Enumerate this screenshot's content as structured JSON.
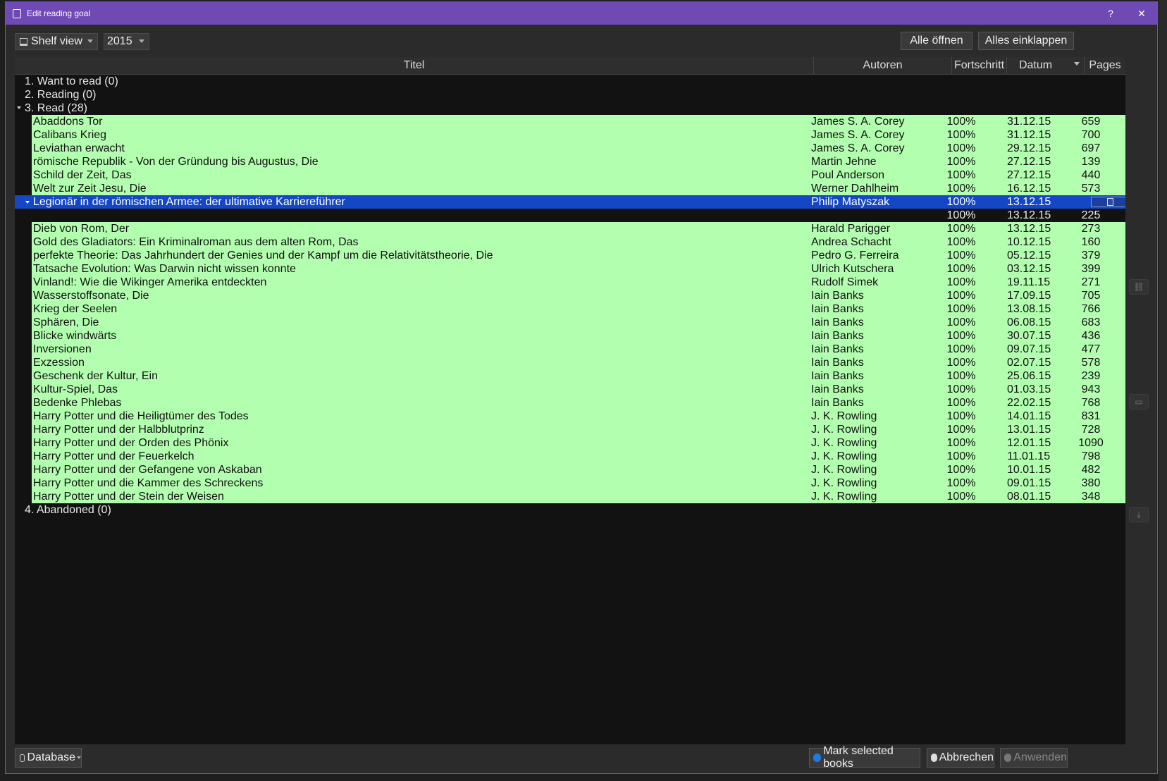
{
  "window": {
    "title": "Edit reading goal",
    "help": "?",
    "close": "✕"
  },
  "toolbar": {
    "view_label": "Shelf view",
    "year": "2015",
    "expand_all": "Alle öffnen",
    "collapse_all": "Alles einklappen"
  },
  "columns": {
    "title": "Titel",
    "authors": "Autoren",
    "progress": "Fortschritt",
    "date": "Datum",
    "pages": "Pages"
  },
  "groups": [
    {
      "label": "1. Want to read (0)"
    },
    {
      "label": "2. Reading (0)"
    },
    {
      "label": "3. Read (28)"
    },
    {
      "label": "4. Abandoned (0)"
    }
  ],
  "books": [
    {
      "title": "Abaddons Tor",
      "author": "James S. A. Corey",
      "progress": "100%",
      "date": "31.12.15",
      "pages": "659"
    },
    {
      "title": "Calibans Krieg",
      "author": "James S. A. Corey",
      "progress": "100%",
      "date": "31.12.15",
      "pages": "700"
    },
    {
      "title": "Leviathan erwacht",
      "author": "James S. A. Corey",
      "progress": "100%",
      "date": "29.12.15",
      "pages": "697"
    },
    {
      "title": "römische Republik - Von der Gründung bis Augustus, Die",
      "author": "Martin Jehne",
      "progress": "100%",
      "date": "27.12.15",
      "pages": "139"
    },
    {
      "title": "Schild der Zeit, Das",
      "author": "Poul Anderson",
      "progress": "100%",
      "date": "27.12.15",
      "pages": "440"
    },
    {
      "title": "Welt zur Zeit Jesu, Die",
      "author": "Werner Dahlheim",
      "progress": "100%",
      "date": "16.12.15",
      "pages": "573"
    }
  ],
  "selected": {
    "title": "Legionär in der römischen Armee: der ultimative Karriereführer",
    "author": "Philip Matyszak",
    "progress": "100%",
    "date": "13.12.15",
    "pages_icon": "document-icon"
  },
  "subrow": {
    "progress": "100%",
    "date": "13.12.15",
    "pages": "225"
  },
  "books2": [
    {
      "title": "Dieb von Rom, Der",
      "author": "Harald Parigger",
      "progress": "100%",
      "date": "13.12.15",
      "pages": "273"
    },
    {
      "title": "Gold des Gladiators: Ein Kriminalroman aus dem alten Rom, Das",
      "author": "Andrea Schacht",
      "progress": "100%",
      "date": "10.12.15",
      "pages": "160"
    },
    {
      "title": "perfekte Theorie: Das Jahrhundert der Genies und der Kampf um die Relativitätstheorie, Die",
      "author": "Pedro G. Ferreira",
      "progress": "100%",
      "date": "05.12.15",
      "pages": "379"
    },
    {
      "title": "Tatsache Evolution: Was Darwin nicht wissen konnte",
      "author": "Ulrich Kutschera",
      "progress": "100%",
      "date": "03.12.15",
      "pages": "399"
    },
    {
      "title": "Vinland!: Wie die Wikinger Amerika entdeckten",
      "author": "Rudolf Simek",
      "progress": "100%",
      "date": "19.11.15",
      "pages": "271"
    },
    {
      "title": "Wasserstoffsonate, Die",
      "author": "Iain Banks",
      "progress": "100%",
      "date": "17.09.15",
      "pages": "705"
    },
    {
      "title": "Krieg der Seelen",
      "author": "Iain Banks",
      "progress": "100%",
      "date": "13.08.15",
      "pages": "766"
    },
    {
      "title": "Sphären, Die",
      "author": "Iain Banks",
      "progress": "100%",
      "date": "06.08.15",
      "pages": "683"
    },
    {
      "title": "Blicke windwärts",
      "author": "Iain Banks",
      "progress": "100%",
      "date": "30.07.15",
      "pages": "436"
    },
    {
      "title": "Inversionen",
      "author": "Iain Banks",
      "progress": "100%",
      "date": "09.07.15",
      "pages": "477"
    },
    {
      "title": "Exzession",
      "author": "Iain Banks",
      "progress": "100%",
      "date": "02.07.15",
      "pages": "578"
    },
    {
      "title": "Geschenk der Kultur, Ein",
      "author": "Iain Banks",
      "progress": "100%",
      "date": "25.06.15",
      "pages": "239"
    },
    {
      "title": "Kultur-Spiel, Das",
      "author": "Iain Banks",
      "progress": "100%",
      "date": "01.03.15",
      "pages": "943"
    },
    {
      "title": "Bedenke Phlebas",
      "author": "Iain Banks",
      "progress": "100%",
      "date": "22.02.15",
      "pages": "768"
    },
    {
      "title": "Harry Potter und die Heiligtümer des Todes",
      "author": "J. K. Rowling",
      "progress": "100%",
      "date": "14.01.15",
      "pages": "831"
    },
    {
      "title": "Harry Potter und der Halbblutprinz",
      "author": "J. K. Rowling",
      "progress": "100%",
      "date": "13.01.15",
      "pages": "728"
    },
    {
      "title": "Harry Potter und der Orden des Phönix",
      "author": "J. K. Rowling",
      "progress": "100%",
      "date": "12.01.15",
      "pages": "1090"
    },
    {
      "title": "Harry Potter und der Feuerkelch",
      "author": "J. K. Rowling",
      "progress": "100%",
      "date": "11.01.15",
      "pages": "798"
    },
    {
      "title": "Harry Potter und der Gefangene von Askaban",
      "author": "J. K. Rowling",
      "progress": "100%",
      "date": "10.01.15",
      "pages": "482"
    },
    {
      "title": "Harry Potter und die Kammer des Schreckens",
      "author": "J. K. Rowling",
      "progress": "100%",
      "date": "09.01.15",
      "pages": "380"
    },
    {
      "title": "Harry Potter und der Stein der Weisen",
      "author": "J. K. Rowling",
      "progress": "100%",
      "date": "08.01.15",
      "pages": "348"
    }
  ],
  "side_icons": [
    "unlink-icon",
    "save-icon",
    "move-down-icon"
  ],
  "bottom": {
    "database": "Database",
    "mark": "Mark selected books",
    "cancel": "Abbrechen",
    "apply": "Anwenden"
  },
  "colors": {
    "accent": "#6f4ab5",
    "read_row": "#b3ffb0",
    "selection": "#1546c6"
  }
}
